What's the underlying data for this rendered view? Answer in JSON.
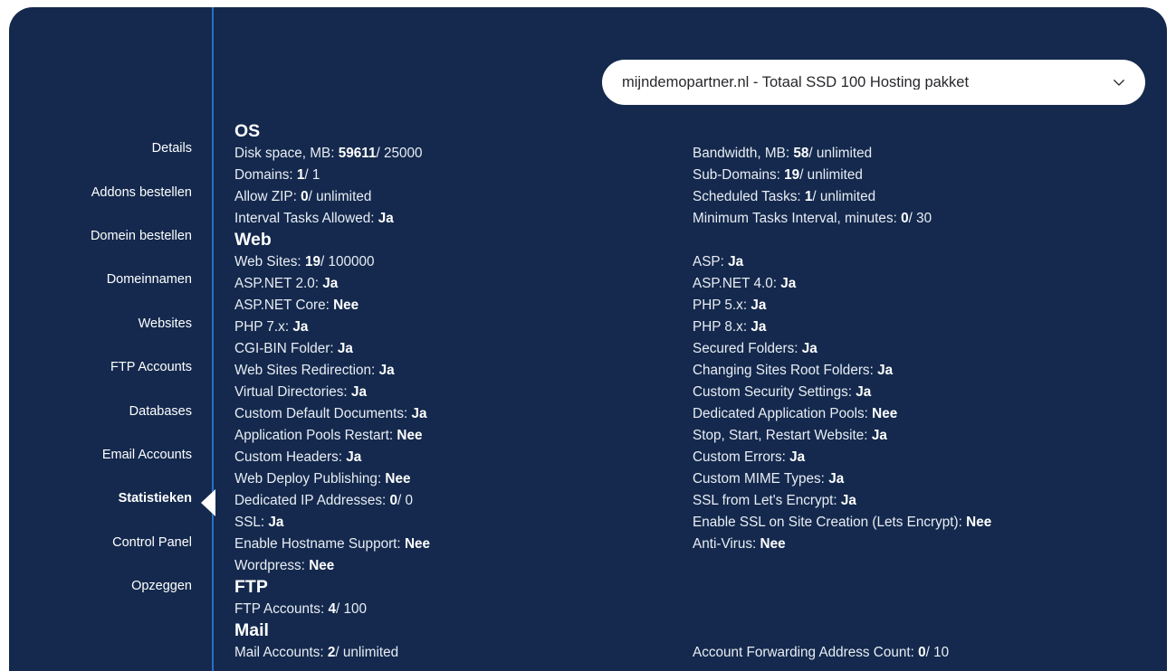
{
  "theme": {
    "panel_bg": "#14294d",
    "divider": "#2a6fc4",
    "text": "#e9edf4",
    "accent_white": "#ffffff"
  },
  "selector": {
    "value": "mijndemopartner.nl - Totaal SSD 100 Hosting pakket",
    "icon": "chevron-down-icon"
  },
  "sidebar": {
    "items": [
      {
        "label": "Details",
        "active": false
      },
      {
        "label": "Addons bestellen",
        "active": false
      },
      {
        "label": "Domein bestellen",
        "active": false
      },
      {
        "label": "Domeinnamen",
        "active": false
      },
      {
        "label": "Websites",
        "active": false
      },
      {
        "label": "FTP Accounts",
        "active": false
      },
      {
        "label": "Databases",
        "active": false
      },
      {
        "label": "Email Accounts",
        "active": false
      },
      {
        "label": "Statistieken",
        "active": true
      },
      {
        "label": "Control Panel",
        "active": false
      },
      {
        "label": "Opzeggen",
        "active": false
      }
    ]
  },
  "left_column": [
    {
      "type": "heading",
      "label": "OS"
    },
    {
      "type": "row",
      "label": "Disk space, MB:",
      "value": "59611",
      "rest": " / 25000"
    },
    {
      "type": "row",
      "label": "Domains:",
      "value": "1",
      "rest": " / 1"
    },
    {
      "type": "row",
      "label": "Allow ZIP:",
      "value": "0",
      "rest": " / unlimited"
    },
    {
      "type": "row",
      "label": "Interval Tasks Allowed:",
      "value": "Ja",
      "rest": ""
    },
    {
      "type": "heading",
      "label": "Web"
    },
    {
      "type": "row",
      "label": "Web Sites:",
      "value": "19",
      "rest": " / 100000"
    },
    {
      "type": "row",
      "label": "ASP.NET 2.0:",
      "value": "Ja",
      "rest": ""
    },
    {
      "type": "row",
      "label": "ASP.NET Core:",
      "value": "Nee",
      "rest": ""
    },
    {
      "type": "row",
      "label": "PHP 7.x:",
      "value": "Ja",
      "rest": ""
    },
    {
      "type": "row",
      "label": "CGI-BIN Folder:",
      "value": "Ja",
      "rest": ""
    },
    {
      "type": "row",
      "label": "Web Sites Redirection:",
      "value": "Ja",
      "rest": ""
    },
    {
      "type": "row",
      "label": "Virtual Directories:",
      "value": "Ja",
      "rest": ""
    },
    {
      "type": "row",
      "label": "Custom Default Documents:",
      "value": "Ja",
      "rest": ""
    },
    {
      "type": "row",
      "label": "Application Pools Restart:",
      "value": "Nee",
      "rest": ""
    },
    {
      "type": "row",
      "label": "Custom Headers:",
      "value": "Ja",
      "rest": ""
    },
    {
      "type": "row",
      "label": "Web Deploy Publishing:",
      "value": "Nee",
      "rest": ""
    },
    {
      "type": "row",
      "label": "Dedicated IP Addresses:",
      "value": "0",
      "rest": " / 0"
    },
    {
      "type": "row",
      "label": "SSL:",
      "value": "Ja",
      "rest": ""
    },
    {
      "type": "row",
      "label": "Enable Hostname Support:",
      "value": "Nee",
      "rest": ""
    },
    {
      "type": "row",
      "label": "Wordpress:",
      "value": "Nee",
      "rest": ""
    },
    {
      "type": "heading",
      "label": "FTP"
    },
    {
      "type": "row",
      "label": "FTP Accounts:",
      "value": "4",
      "rest": " / 100"
    },
    {
      "type": "heading",
      "label": "Mail"
    },
    {
      "type": "row",
      "label": "Mail Accounts:",
      "value": "2",
      "rest": " / unlimited"
    }
  ],
  "right_column": [
    {
      "type": "spacer"
    },
    {
      "type": "row",
      "label": "Bandwidth, MB:",
      "value": "58",
      "rest": " / unlimited"
    },
    {
      "type": "row",
      "label": "Sub-Domains:",
      "value": "19",
      "rest": " / unlimited"
    },
    {
      "type": "row",
      "label": "Scheduled Tasks:",
      "value": "1",
      "rest": " / unlimited"
    },
    {
      "type": "row",
      "label": "Minimum Tasks Interval, minutes:",
      "value": "0",
      "rest": " / 30"
    },
    {
      "type": "spacer"
    },
    {
      "type": "row",
      "label": "ASP:",
      "value": "Ja",
      "rest": ""
    },
    {
      "type": "row",
      "label": "ASP.NET 4.0:",
      "value": "Ja",
      "rest": ""
    },
    {
      "type": "row",
      "label": "PHP 5.x:",
      "value": "Ja",
      "rest": ""
    },
    {
      "type": "row",
      "label": "PHP 8.x:",
      "value": "Ja",
      "rest": ""
    },
    {
      "type": "row",
      "label": "Secured Folders:",
      "value": "Ja",
      "rest": ""
    },
    {
      "type": "row",
      "label": "Changing Sites Root Folders:",
      "value": "Ja",
      "rest": ""
    },
    {
      "type": "row",
      "label": "Custom Security Settings:",
      "value": "Ja",
      "rest": ""
    },
    {
      "type": "row",
      "label": "Dedicated Application Pools:",
      "value": "Nee",
      "rest": ""
    },
    {
      "type": "row",
      "label": "Stop, Start, Restart Website:",
      "value": "Ja",
      "rest": ""
    },
    {
      "type": "row",
      "label": "Custom Errors:",
      "value": "Ja",
      "rest": ""
    },
    {
      "type": "row",
      "label": "Custom MIME Types:",
      "value": "Ja",
      "rest": ""
    },
    {
      "type": "row",
      "label": "SSL from Let's Encrypt:",
      "value": "Ja",
      "rest": ""
    },
    {
      "type": "row",
      "label": "Enable SSL on Site Creation (Lets Encrypt):",
      "value": "Nee",
      "rest": ""
    },
    {
      "type": "row",
      "label": "Anti-Virus:",
      "value": "Nee",
      "rest": ""
    },
    {
      "type": "spacer"
    },
    {
      "type": "spacer"
    },
    {
      "type": "spacer"
    },
    {
      "type": "spacer"
    },
    {
      "type": "row",
      "label": "Account Forwarding Address Count:",
      "value": "0",
      "rest": " / 10"
    }
  ]
}
